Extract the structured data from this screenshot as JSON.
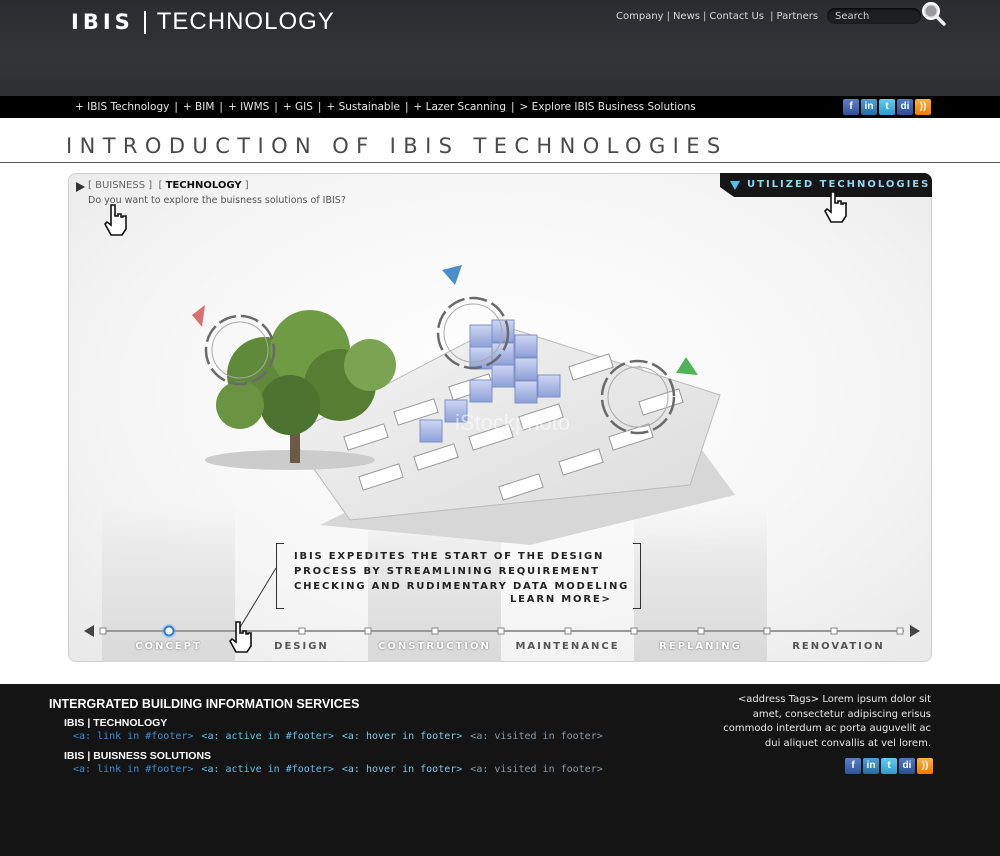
{
  "header": {
    "logo_ibis": "IBIS",
    "logo_technology": "TECHNOLOGY",
    "top_nav": [
      {
        "label": "Company"
      },
      {
        "label": "News"
      },
      {
        "label": "Contact Us"
      },
      {
        "label": "Partners"
      }
    ],
    "search_placeholder": "Search"
  },
  "navbar": {
    "links": [
      {
        "label": "+ IBIS Technology"
      },
      {
        "label": "+ BIM"
      },
      {
        "label": "+ IWMS"
      },
      {
        "label": "+  GIS"
      },
      {
        "label": "+ Sustainable"
      },
      {
        "label": "+ Lazer Scanning"
      },
      {
        "label": "> Explore IBIS Business Solutions"
      }
    ],
    "social_icons": [
      "facebook-icon",
      "linkedin-icon",
      "twitter-icon",
      "digg-icon",
      "rss-icon"
    ]
  },
  "page": {
    "title": "INTRODUCTION OF IBIS TECHNOLOGIES"
  },
  "panel": {
    "breadcrumb_business": "[ BUISNESS ]",
    "breadcrumb_technology": "TECHNOLOGY",
    "breadcrumb_open": "[",
    "breadcrumb_close": "]",
    "subtext": "Do you want to explore the buisness solutions of IBIS?",
    "utilized_label": "UTILIZED TECHNOLOGIES",
    "description_lines": [
      "IBIS EXPEDITES THE START OF THE DESIGN",
      "PROCESS BY STREAMLINING REQUIREMENT",
      "CHECKING AND RUDIMENTARY DATA MODELING"
    ],
    "learn_more": "LEARN MORE>",
    "watermark": "iStockphoto",
    "stages": [
      {
        "label": "CONCEPT",
        "active": true
      },
      {
        "label": "DESIGN",
        "active": false
      },
      {
        "label": "CONSTRUCTION",
        "active": false
      },
      {
        "label": "MAINTENANCE",
        "active": false
      },
      {
        "label": "REPLANING",
        "active": false
      },
      {
        "label": "RENOVATION",
        "active": false
      }
    ]
  },
  "footer": {
    "title": "INTERGRATED BUILDING INFORMATION SERVICES",
    "sections": [
      {
        "heading": "IBIS | TECHNOLOGY"
      },
      {
        "heading": "IBIS | BUISNESS SOLUTIONS"
      }
    ],
    "link_samples": {
      "link": "<a: link in #footer>",
      "active": "<a: active in #footer>",
      "hover": "<a: hover in footer>",
      "visited": "<a: visited in footer>"
    },
    "address_lines": [
      "<address Tags>  Lorem ipsum dolor sit",
      "amet, consectetur adipiscing erisus",
      "commodo interdum ac porta auguvelit ac",
      "dui aliquet convallis at vel lorem."
    ]
  },
  "colors": {
    "header_bg": "#303134",
    "accent_cyan": "#4fc3e6",
    "footer_bg": "#141414"
  }
}
